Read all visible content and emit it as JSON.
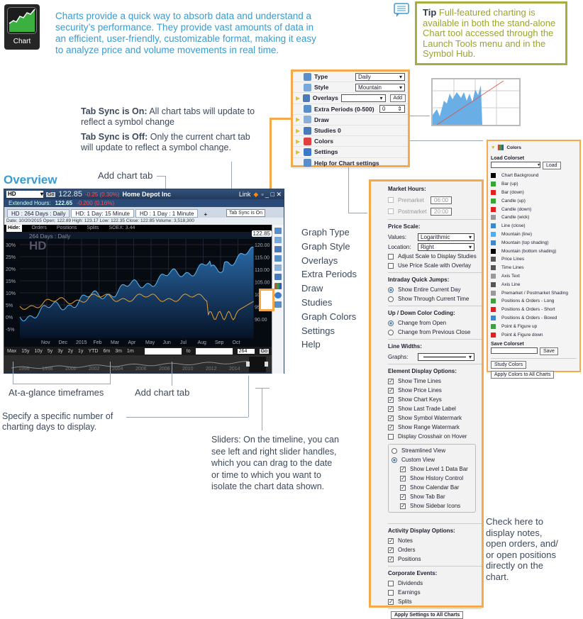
{
  "intro": {
    "app_icon_label": "Chart",
    "text": "Charts provide a quick way to absorb data and understand a security’s performance. They provide vast amounts of data in an efficient, user-friendly, customizable format, making it easy to analyze price and volume movements in real time."
  },
  "tip": {
    "label": "Tip",
    "text": "Full-featured charting is available in both the stand-alone Chart tool accessed through the Launch Tools menu and in the Symbol Hub."
  },
  "tab_sync": {
    "on_label": "Tab Sync is On:",
    "on_text": "All chart tabs will update to reflect a symbol change",
    "off_label": "Tab Sync is Off:",
    "off_text": "Only the current chart tab will update to reflect a symbol change."
  },
  "overview_title": "Overview",
  "annotations": {
    "add_chart_tab_top": "Add chart tab",
    "at_a_glance": "At-a-glance timeframes",
    "add_chart_tab_bottom": "Add chart tab",
    "specify_days": "Specify a specific number of charting days to display.",
    "sliders": "Sliders: On the timeline, you can see left  and right  slider handles, which you can drag to the date or time to which you want to isolate the chart data shown.",
    "check_here": "Check here to display notes, open orders, and/ or open positions directly on the chart."
  },
  "graph_labels": [
    "Graph Type",
    "Graph Style",
    "Overlays",
    "Extra Periods",
    "Draw",
    "Studies",
    "Graph Colors",
    "Settings",
    "Help"
  ],
  "chart_window": {
    "symbol": "HD",
    "go": "Go",
    "price": "122.85",
    "change": "-0.25 (0.30%)",
    "company": "Home Depot Inc",
    "link": "Link",
    "extended_label": "Extended Hours:",
    "extended_price": "122.65",
    "extended_change": "-0.200 (0.16%)",
    "tabs": [
      "HD : 264  Days : Daily",
      "HD: 1 Day: 15 Minute",
      "HD : 1  Day : 1 Minute"
    ],
    "add_tab": "+",
    "tab_sync_button": "Tab Sync is On",
    "info": "Date: 10/20/2015  Open: 122.89  High: 123.17  Low: 122.35  Close: 122.85  Volume: 3,518,300",
    "hide_bar": [
      "Hide:",
      "Orders",
      "Positions",
      "Splits",
      "SOEX: 3.44"
    ],
    "range_label": "264  Days : Daily",
    "watermark": "HD",
    "last_trade": "122.85",
    "left_axis": [
      "30%",
      "25%",
      "20%",
      "15%",
      "10%",
      "5%",
      "0%",
      "-5%"
    ],
    "right_axis": [
      "120.00",
      "115.00",
      "110.00",
      "105.00",
      "100.00",
      "95.00",
      "90.00"
    ],
    "x_axis": [
      "Nov",
      "Dec",
      "2015",
      "Feb",
      "Mar",
      "Apr",
      "May",
      "Jun",
      "Jul",
      "Aug",
      "Sep",
      "Oct"
    ],
    "timeframes": [
      "Max",
      "15y",
      "10y",
      "5y",
      "3y",
      "2y",
      "1y",
      "YTD",
      "6m",
      "3m",
      "1m"
    ],
    "to_label": "to",
    "days_value": "264",
    "days_go": "Go",
    "timeline_years": [
      "1996",
      "1998",
      "2000",
      "2002",
      "2004",
      "2006",
      "2008",
      "2010",
      "2012",
      "2014"
    ]
  },
  "settings_menu": {
    "rows": [
      {
        "label": "Type",
        "value": "Daily"
      },
      {
        "label": "Style",
        "value": "Mountain"
      },
      {
        "label": "Overlays",
        "value": "",
        "button": "Add"
      },
      {
        "label": "Extra Periods (0-500)",
        "value": "0"
      },
      {
        "label": "Draw"
      },
      {
        "label": "Studies 0"
      },
      {
        "label": "Colors"
      },
      {
        "label": "Settings"
      },
      {
        "label": "Help for Chart settings"
      }
    ]
  },
  "colors_panel": {
    "title": "Colors",
    "load_label": "Load Colorset",
    "load_button": "Load",
    "items": [
      {
        "label": "Chart Background",
        "color": "#000000"
      },
      {
        "label": "Bar (up)",
        "color": "#3aa43a"
      },
      {
        "label": "Bar (down)",
        "color": "#e02020"
      },
      {
        "label": "Candle (up)",
        "color": "#3aa43a"
      },
      {
        "label": "Candle (down)",
        "color": "#e02020"
      },
      {
        "label": "Candle (wick)",
        "color": "#999999"
      },
      {
        "label": "Line (close)",
        "color": "#3a8ad0"
      },
      {
        "label": "Mountain (line)",
        "color": "#4ab0f0"
      },
      {
        "label": "Mountain (top shading)",
        "color": "#3a8ad0"
      },
      {
        "label": "Mountain (bottom shading)",
        "color": "#000000"
      },
      {
        "label": "Price Lines",
        "color": "#555555"
      },
      {
        "label": "Time Lines",
        "color": "#555555"
      },
      {
        "label": "Axis Text",
        "color": "#999999"
      },
      {
        "label": "Axis Line",
        "color": "#555555"
      },
      {
        "label": "Premarket / Postmarket Shading",
        "color": "#999999"
      },
      {
        "label": "Positions & Orders - Long",
        "color": "#3aa43a"
      },
      {
        "label": "Positions & Orders - Short",
        "color": "#e02020"
      },
      {
        "label": "Positions & Orders - Boxed",
        "color": "#3a8ad0"
      },
      {
        "label": "Point & Figure up",
        "color": "#3aa43a"
      },
      {
        "label": "Point & Figure down",
        "color": "#e02020"
      }
    ],
    "save_label": "Save Colorset",
    "save_button": "Save",
    "study_colors_button": "Study Colors",
    "apply_button": "Apply Colors to All Charts"
  },
  "settings_panel": {
    "market_hours": "Market Hours:",
    "premarket": "Premarket",
    "premarket_time": "06:00",
    "postmarket": "Postmarket",
    "postmarket_time": "20:00",
    "price_scale": "Price Scale:",
    "values_label": "Values:",
    "values_value": "Logarithmic",
    "location_label": "Location:",
    "location_value": "Right",
    "adjust_scale": "Adjust Scale to Display Studies",
    "use_price_scale": "Use Price Scale with Overlay",
    "intraday": "Intraday Quick Jumps:",
    "show_entire": "Show Entire Current Day",
    "show_through": "Show Through Current Time",
    "updown": "Up / Down Color Coding:",
    "change_open": "Change from Open",
    "change_prev": "Change from Previous Close",
    "line_widths": "Line Widths:",
    "graphs_label": "Graphs:",
    "element_display": "Element Display Options:",
    "elements": [
      {
        "label": "Show Time Lines",
        "checked": true
      },
      {
        "label": "Show Price Lines",
        "checked": true
      },
      {
        "label": "Show Chart Keys",
        "checked": true
      },
      {
        "label": "Show Last Trade Label",
        "checked": true
      },
      {
        "label": "Show Symbol Watermark",
        "checked": true
      },
      {
        "label": "Show Range Watermark",
        "checked": true
      },
      {
        "label": "Display Crosshair on Hover",
        "checked": false
      }
    ],
    "streamlined": "Streamlined View",
    "custom": "Custom View",
    "custom_items": [
      "Show Level 1 Data Bar",
      "Show History Control",
      "Show Calendar Bar",
      "Show Tab Bar",
      "Show Sidebar Icons"
    ],
    "activity": "Activity Display Options:",
    "activity_items": [
      "Notes",
      "Orders",
      "Positions"
    ],
    "corporate": "Corporate Events:",
    "corporate_items": [
      {
        "label": "Dividends",
        "checked": false
      },
      {
        "label": "Earnings",
        "checked": false
      },
      {
        "label": "Splits",
        "checked": true
      }
    ],
    "apply_button": "Apply Settings to All Charts"
  }
}
